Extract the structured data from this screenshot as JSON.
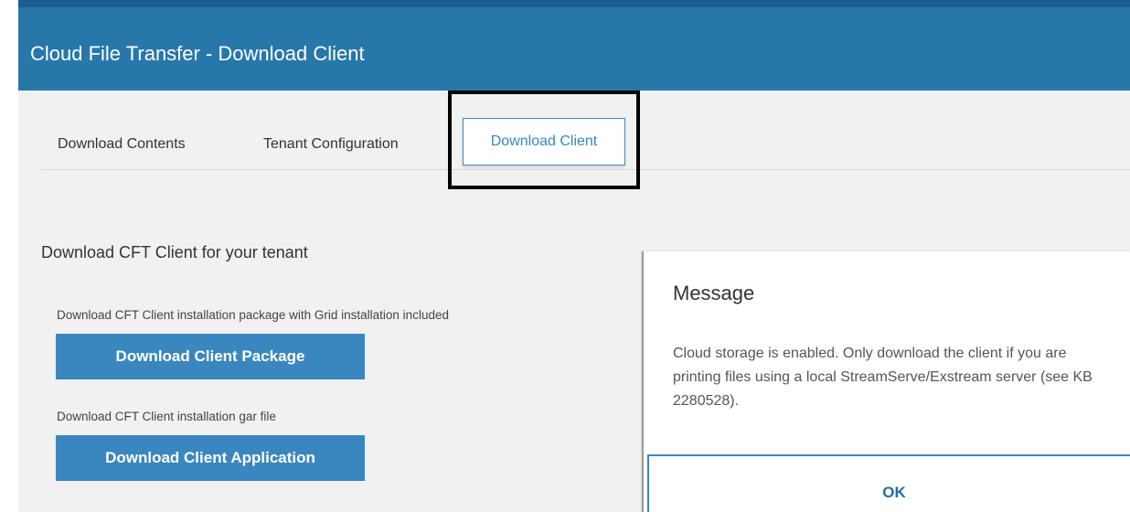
{
  "header": {
    "title": "Cloud File Transfer - Download Client"
  },
  "tabs": [
    {
      "label": "Download Contents",
      "active": false
    },
    {
      "label": "Tenant Configuration",
      "active": false
    },
    {
      "label": "Download Client",
      "active": true
    }
  ],
  "main": {
    "section_title": "Download CFT Client for your tenant",
    "package": {
      "description": "Download CFT Client installation package with Grid installation included",
      "button_label": "Download Client Package"
    },
    "application": {
      "description": "Download CFT Client installation gar file",
      "button_label": "Download Client Application"
    }
  },
  "dialog": {
    "title": "Message",
    "message": "Cloud storage is enabled. Only download the client if you are printing files using a local StreamServe/Exstream server (see KB 2280528).",
    "ok_label": "OK"
  },
  "colors": {
    "header_bg": "#2777ab",
    "accent": "#3a87c0",
    "page_bg": "#f1f1f1",
    "highlight_border": "#000000"
  }
}
